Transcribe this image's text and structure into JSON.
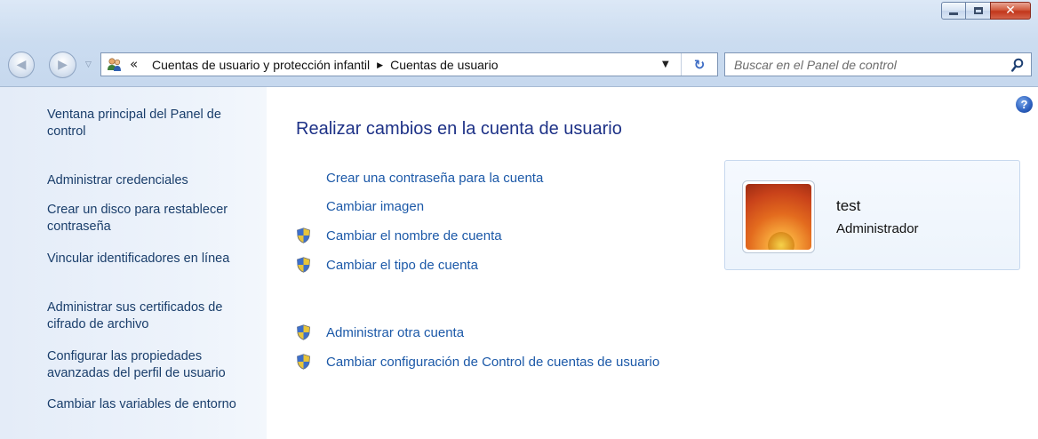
{
  "window": {
    "controls": {
      "minimize": "minimize",
      "maximize": "maximize",
      "close": "close"
    }
  },
  "nav": {
    "address": {
      "overflow": "«",
      "crumbs": [
        "Cuentas de usuario y protección infantil",
        "Cuentas de usuario"
      ],
      "separator": "▶"
    },
    "search": {
      "placeholder": "Buscar en el Panel de control"
    }
  },
  "sidebar": {
    "items": [
      {
        "label": "Ventana principal del Panel de control"
      },
      {
        "label": "Administrar credenciales"
      },
      {
        "label": "Crear un disco para restablecer contraseña"
      },
      {
        "label": "Vincular identificadores en línea"
      },
      {
        "label": "Administrar sus certificados de cifrado de archivo"
      },
      {
        "label": "Configurar las propiedades avanzadas del perfil de usuario"
      },
      {
        "label": "Cambiar las variables de entorno"
      }
    ]
  },
  "main": {
    "title": "Realizar cambios en la cuenta de usuario",
    "tasks": [
      {
        "label": "Crear una contraseña para la cuenta",
        "icon": "none"
      },
      {
        "label": "Cambiar imagen",
        "icon": "none"
      },
      {
        "label": "Cambiar el nombre de cuenta",
        "icon": "uac-shield-icon"
      },
      {
        "label": "Cambiar el tipo de cuenta",
        "icon": "uac-shield-icon"
      }
    ],
    "other_tasks": [
      {
        "label": "Administrar otra cuenta",
        "icon": "uac-shield-icon"
      },
      {
        "label": "Cambiar configuración de Control de cuentas de usuario",
        "icon": "uac-shield-icon"
      }
    ],
    "account": {
      "name": "test",
      "type": "Administrador"
    }
  },
  "colors": {
    "link": "#1c59a8",
    "title": "#1e3287",
    "sidebar_text": "#1a3e6b",
    "close_button": "#c2361b"
  }
}
